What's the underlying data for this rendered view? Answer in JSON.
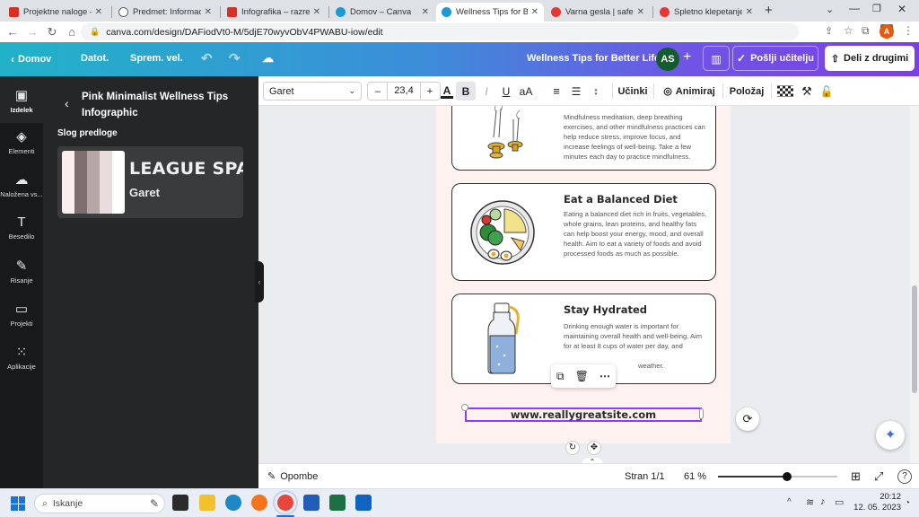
{
  "browser": {
    "tabs": [
      {
        "title": "Projektne naloge – ra",
        "active": false
      },
      {
        "title": "Predmet: Informacijsk",
        "active": false
      },
      {
        "title": "Infografika – razrednic",
        "active": false
      },
      {
        "title": "Domov – Canva",
        "active": false
      },
      {
        "title": "Wellness Tips for Bette",
        "active": true
      },
      {
        "title": "Varna gesla | safe.si",
        "active": false
      },
      {
        "title": "Spletno klepetanje | s",
        "active": false
      }
    ],
    "new_tab": "+",
    "url": "canva.com/design/DAFiodVt0-M/5djE70wyvObV4PWABU-iow/edit",
    "profile_initial": "A"
  },
  "canva_header": {
    "home": "Domov",
    "file": "Datot.",
    "resize": "Sprem. vel.",
    "design_title": "Wellness Tips for Better Life",
    "avatar_initials": "AS",
    "send_teacher": "Pošlji učitelju",
    "share": "Deli z drugimi"
  },
  "toolbar": {
    "font": "Garet",
    "font_size": "23,4",
    "minus": "–",
    "plus": "+",
    "bold": "B",
    "italic": "I",
    "underline": "U",
    "case": "aA",
    "effects": "Učinki",
    "animate": "Animiraj",
    "position": "Položaj"
  },
  "rail": [
    {
      "label": "Izdelek",
      "icon": "layout-icon",
      "active": true
    },
    {
      "label": "Elementi",
      "icon": "shapes-icon",
      "active": false
    },
    {
      "label": "Naložena vs...",
      "icon": "upload-icon",
      "active": false
    },
    {
      "label": "Besedilo",
      "icon": "text-icon",
      "active": false
    },
    {
      "label": "Risanje",
      "icon": "draw-icon",
      "active": false
    },
    {
      "label": "Projekti",
      "icon": "folder-icon",
      "active": false
    },
    {
      "label": "Aplikacije",
      "icon": "apps-icon",
      "active": false
    }
  ],
  "panel": {
    "title": "Pink Minimalist Wellness Tips Infographic",
    "section": "Slog predloge",
    "style_heading_font": "LEAGUE SPAR",
    "style_body_font": "Garet",
    "swatches": [
      "#fbefee",
      "#7d6f70",
      "#b6a7a7",
      "#e9dcdc"
    ]
  },
  "design": {
    "card1_text": "Mindfulness meditation, deep breathing exercises, and other mindfulness practices can help reduce stress, improve focus, and increase feelings of well-being. Take a few minutes each day to practice mindfulness.",
    "card2_title": "Eat a Balanced Diet",
    "card2_text": "Eating a balanced diet rich in fruits, vegetables, whole grains, lean proteins, and healthy fats can help boost your energy, mood, and overall health. Aim to eat a variety of foods and avoid processed foods as much as possible.",
    "card3_title": "Stay Hydrated",
    "card3_text_a": "Drinking enough water is important for maintaining overall health and well-being. Aim for at least 8 cups of water per day, and increase your intake if you're physically",
    "card3_text_b": "weather.",
    "website": "www.reallygreatsite.com"
  },
  "bottom": {
    "notes": "Opombe",
    "page": "Stran 1/1",
    "zoom": "61 %",
    "zoom_fraction": 0.61
  },
  "taskbar": {
    "search": "Iskanje",
    "time": "20:12",
    "date": "12. 05. 2023"
  },
  "colors": {
    "accent": "#7d2ae8",
    "selection": "#8b3dff",
    "header_start": "#21b2c8",
    "header_end": "#7c3fe3"
  }
}
